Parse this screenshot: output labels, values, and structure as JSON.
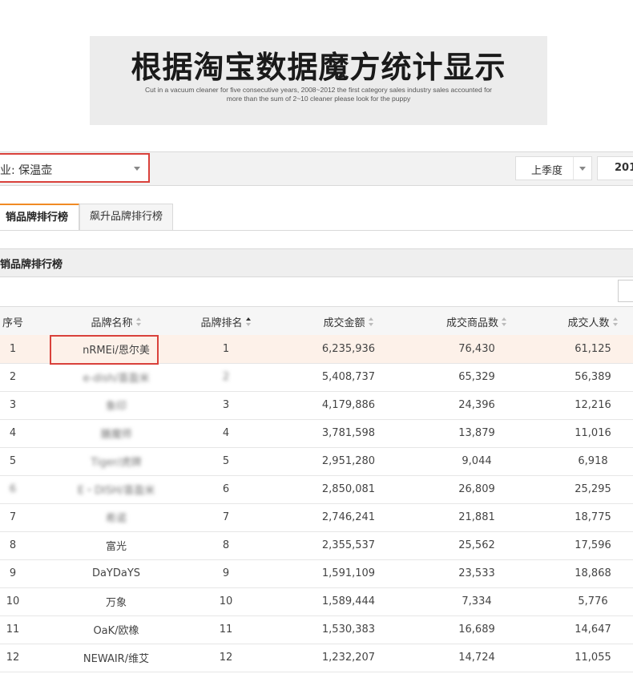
{
  "banner": {
    "title": "根据淘宝数据魔方统计显示",
    "subtitle": "Cut in a vacuum cleaner for five consecutive years, 2008~2012 the first category sales industry sales accounted for more than the sum of 2~10 cleaner please look for the puppy"
  },
  "filters": {
    "industry": "业: 保温壶",
    "period": "上季度",
    "year": "201"
  },
  "tabs": [
    "销品牌排行榜",
    "飙升品牌排行榜"
  ],
  "section_title": "销品牌排行榜",
  "table": {
    "columns": [
      "序号",
      "品牌名称",
      "品牌排名",
      "成交金额",
      "成交商品数",
      "成交人数"
    ],
    "rows": [
      {
        "no": "1",
        "brand": "nRMEi/恩尔美",
        "rank": "1",
        "amount": "6,235,936",
        "items": "76,430",
        "buyers": "61,125"
      },
      {
        "no": "2",
        "brand": "e-dish/喜盈米",
        "rank": "2",
        "amount": "5,408,737",
        "items": "65,329",
        "buyers": "56,389"
      },
      {
        "no": "3",
        "brand": "象印",
        "rank": "3",
        "amount": "4,179,886",
        "items": "24,396",
        "buyers": "12,216"
      },
      {
        "no": "4",
        "brand": "膳魔师",
        "rank": "4",
        "amount": "3,781,598",
        "items": "13,879",
        "buyers": "11,016"
      },
      {
        "no": "5",
        "brand": "Tiger/虎牌",
        "rank": "5",
        "amount": "2,951,280",
        "items": "9,044",
        "buyers": "6,918"
      },
      {
        "no": "6",
        "brand": "E・DISH/喜盈米",
        "rank": "6",
        "amount": "2,850,081",
        "items": "26,809",
        "buyers": "25,295"
      },
      {
        "no": "7",
        "brand": "希诺",
        "rank": "7",
        "amount": "2,746,241",
        "items": "21,881",
        "buyers": "18,775"
      },
      {
        "no": "8",
        "brand": "富光",
        "rank": "8",
        "amount": "2,355,537",
        "items": "25,562",
        "buyers": "17,596"
      },
      {
        "no": "9",
        "brand": "DaYDaYS",
        "rank": "9",
        "amount": "1,591,109",
        "items": "23,533",
        "buyers": "18,868"
      },
      {
        "no": "10",
        "brand": "万象",
        "rank": "10",
        "amount": "1,589,444",
        "items": "7,334",
        "buyers": "5,776"
      },
      {
        "no": "11",
        "brand": "OaK/欧橡",
        "rank": "11",
        "amount": "1,530,383",
        "items": "16,689",
        "buyers": "14,647"
      },
      {
        "no": "12",
        "brand": "NEWAIR/维艾",
        "rank": "12",
        "amount": "1,232,207",
        "items": "14,724",
        "buyers": "11,055"
      }
    ]
  },
  "colors": {
    "accent_tab": "#f08a24",
    "highlight_box": "#d9413b",
    "row_highlight": "#fdf1e9"
  }
}
